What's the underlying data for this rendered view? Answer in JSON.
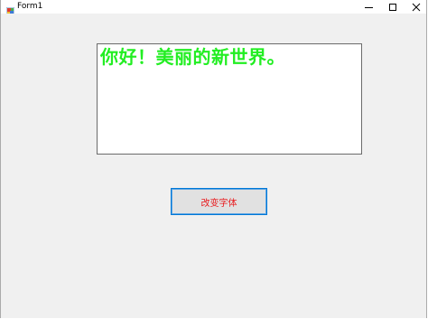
{
  "window": {
    "title": "Form1",
    "icon": "winforms-app-icon",
    "controls": {
      "minimize_icon": "minimize-icon",
      "maximize_icon": "maximize-icon",
      "close_icon": "close-icon"
    }
  },
  "textbox": {
    "text": "你好！美丽的新世界。",
    "text_color": "#22ee22"
  },
  "button": {
    "label": "改变字体",
    "label_color": "#e8191c"
  }
}
